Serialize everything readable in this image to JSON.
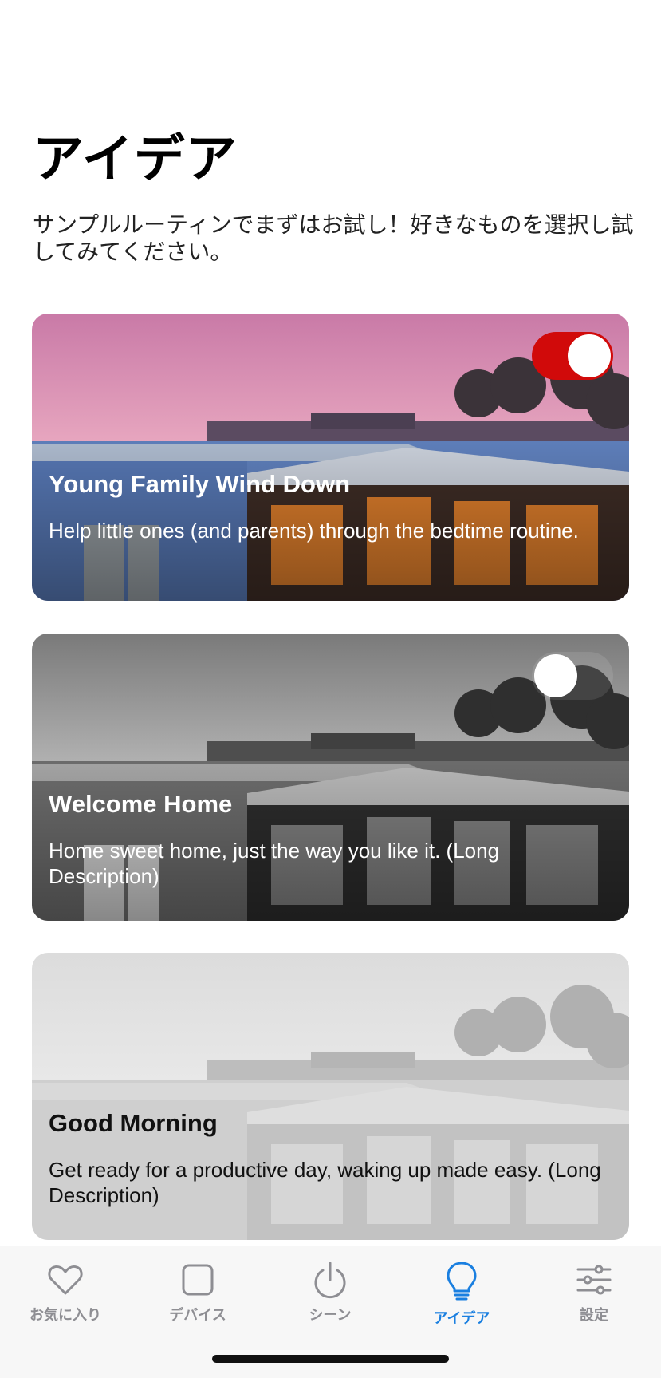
{
  "page": {
    "title": "アイデア",
    "subtitle": "サンプルルーティンでまずはお試し！好きなものを選択し試してみてください。"
  },
  "ideas": [
    {
      "title": "Young Family Wind Down",
      "description": "Help little ones (and parents) through the bedtime routine.",
      "toggle": "on",
      "image": "house-at-dusk-pink-sky"
    },
    {
      "title": "Welcome Home",
      "description": "Home sweet home, just the way you like it. (Long Description)",
      "toggle": "off",
      "image": "house-at-dusk-grayscale"
    },
    {
      "title": "Good Morning",
      "description": "Get ready for a productive day, waking up made easy. (Long Description)",
      "toggle": "none",
      "image": "house-faded-grayscale"
    }
  ],
  "tabbar": {
    "items": [
      {
        "label": "お気に入り",
        "icon": "heart-icon",
        "active": false
      },
      {
        "label": "デバイス",
        "icon": "device-square-icon",
        "active": false
      },
      {
        "label": "シーン",
        "icon": "power-icon",
        "active": false
      },
      {
        "label": "アイデア",
        "icon": "lightbulb-icon",
        "active": true
      },
      {
        "label": "設定",
        "icon": "sliders-icon",
        "active": false
      }
    ]
  },
  "colors": {
    "accent_red": "#d10a0a",
    "active_tab_blue": "#1a7fe0",
    "inactive_tab_gray": "#8e8e93"
  }
}
